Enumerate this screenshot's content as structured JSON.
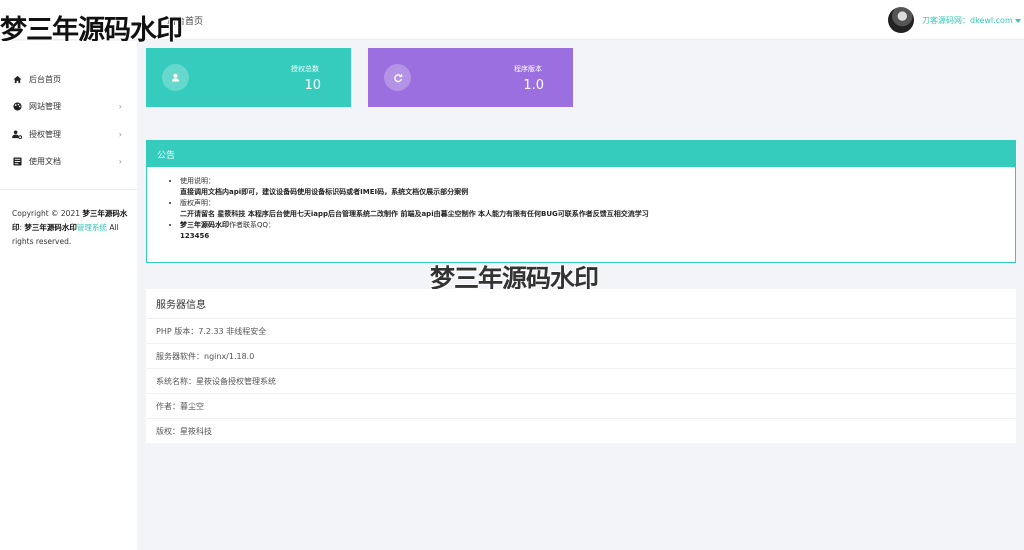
{
  "header": {
    "watermark": "梦三年源码水印",
    "title": "后台首页",
    "user_link": "刀客源码网：dkewl.com"
  },
  "sidebar": {
    "items": [
      {
        "label": "后台首页",
        "icon": "home-icon",
        "arrow": ""
      },
      {
        "label": "网站管理",
        "icon": "palette-icon",
        "arrow": "›"
      },
      {
        "label": "授权管理",
        "icon": "user-gear-icon",
        "arrow": "›"
      },
      {
        "label": "使用文档",
        "icon": "document-icon",
        "arrow": "›"
      }
    ],
    "copyright_prefix": "Copyright © 2021",
    "copyright_wm1": "梦三年源码水印",
    "copyright_wm2": "梦三年源码水印",
    "copyright_link": "管理系统",
    "copyright_suffix": "All rights reserved."
  },
  "stats": [
    {
      "label": "授权总数",
      "value": "10",
      "color": "#35cbbd",
      "icon": "user-icon"
    },
    {
      "label": "程序版本",
      "value": "1.0",
      "color": "#9b6fdf",
      "icon": "refresh-icon"
    }
  ],
  "notice": {
    "title": "公告",
    "items": [
      {
        "heading": "使用说明：",
        "body": "直接调用文档内api即可，建议设备码使用设备标识码或者IMEI码，系统文档仅展示部分案例"
      },
      {
        "heading": "版权声明：",
        "body": "二开请留名 星筱科技 本程序后台使用七天iapp后台管理系统二改制作 前端及api由暮尘空制作 本人能力有限有任何BUG可联系作者反馈互相交流学习"
      },
      {
        "heading": "作者联系QQ：",
        "heading_wm": "梦三年源码水印",
        "body": "123456"
      }
    ]
  },
  "center_watermark": "梦三年源码水印",
  "server": {
    "title": "服务器信息",
    "rows": [
      "PHP 版本：7.2.33 非线程安全",
      "服务器软件：nginx/1.18.0",
      "系统名称：星筱设备授权管理系统",
      "作者：暮尘空",
      "版权：星筱科技"
    ]
  }
}
